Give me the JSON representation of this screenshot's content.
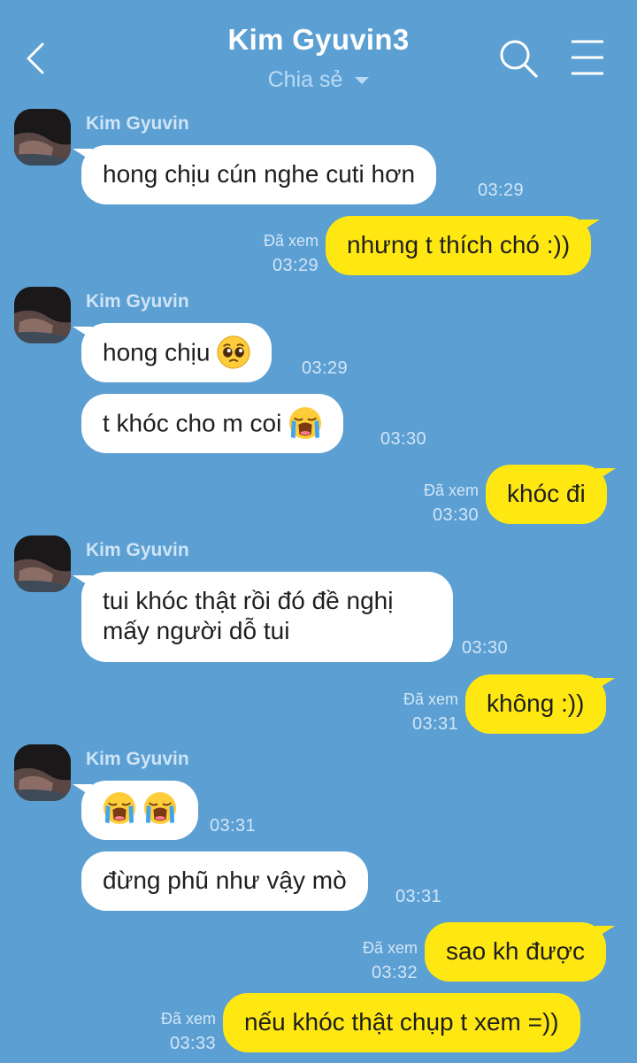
{
  "header": {
    "back_icon": "chevron-left-icon",
    "title": "Kim Gyuvin",
    "member_count": "3",
    "subtitle": "Chia sẻ",
    "search_icon": "search-icon",
    "menu_icon": "hamburger-menu-icon"
  },
  "colors": {
    "background": "#5b9fd3",
    "incoming_bubble": "#ffffff",
    "outgoing_bubble": "#ffe812"
  },
  "contact_name": "Kim Gyuvin",
  "seen_label": "Đã xem",
  "messages": [
    {
      "dir": "in",
      "text": "hong chịu cún nghe cuti hơn",
      "time": "03:29"
    },
    {
      "dir": "out",
      "text": "nhưng t thích chó :))",
      "time": "03:29",
      "status": "Đã xem"
    },
    {
      "dir": "in",
      "text": "hong chịu",
      "emoji": "pleading-face",
      "time": "03:29"
    },
    {
      "dir": "in",
      "text": "t khóc cho m coi",
      "emoji": "loudly-crying-face",
      "time": "03:30"
    },
    {
      "dir": "out",
      "text": "khóc đi",
      "time": "03:30",
      "status": "Đã xem"
    },
    {
      "dir": "in",
      "text": "tui khóc thật rồi đó đề nghị mấy người dỗ tui",
      "time": "03:30"
    },
    {
      "dir": "out",
      "text": "không :))",
      "time": "03:31",
      "status": "Đã xem"
    },
    {
      "dir": "in",
      "text": "",
      "emoji": "loudly-crying-face x2",
      "time": "03:31"
    },
    {
      "dir": "in",
      "text": "đừng phũ như vậy mò",
      "time": "03:31"
    },
    {
      "dir": "out",
      "text": "sao kh được",
      "time": "03:32",
      "status": "Đã xem"
    },
    {
      "dir": "out",
      "text": "nếu khóc thật chụp t xem =))",
      "time": "03:33",
      "status": "Đã xem"
    }
  ]
}
